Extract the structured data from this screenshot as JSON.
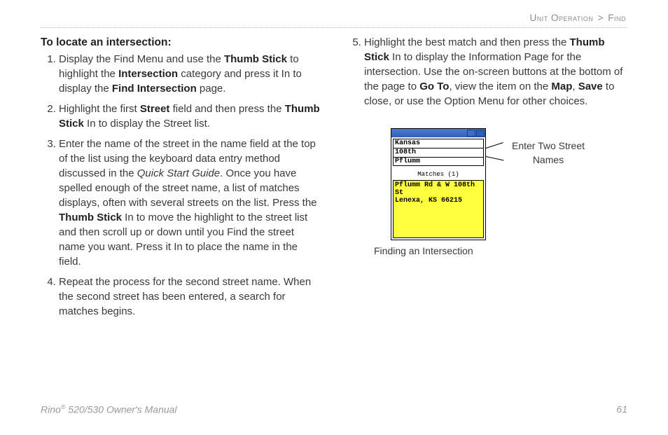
{
  "breadcrumb": {
    "section": "Unit Operation",
    "sep": ">",
    "sub": "Find"
  },
  "heading": "To locate an intersection:",
  "col1": {
    "step1": {
      "pre": "Display the Find Menu and use the ",
      "b1": "Thumb Stick",
      "mid1": " to highlight the ",
      "b2": "Intersection",
      "mid2": " category and press it In to display the ",
      "b3": "Find Intersection",
      "post": " page."
    },
    "step2": {
      "pre": "Highlight the first ",
      "b1": "Street",
      "mid1": " field and then press the ",
      "b2": "Thumb Stick",
      "post": " In to display the Street list."
    },
    "step3": {
      "pre": "Enter the name of the street in the name field at the top of the list using the keyboard data entry method discussed in the ",
      "i1": "Quick Start Guide",
      "mid1": ". Once you have spelled enough of the street name, a list of matches displays, often with several streets on the list. Press the ",
      "b1": "Thumb Stick",
      "post": " In to move the highlight to the street list and then scroll up or down until you Find the street name you want. Press it In to place the name in the field."
    },
    "step4": "Repeat the process for the second street name. When the second street has been entered, a search for matches begins."
  },
  "col2": {
    "step5": {
      "pre": "Highlight the best match and then press the ",
      "b1": "Thumb Stick",
      "mid1": " In to display the Information Page for the intersection. Use the on-screen buttons at the bottom of the page to ",
      "b2": "Go To",
      "mid2": ", view the item on the ",
      "b3": "Map",
      "mid3": ", ",
      "b4": "Save",
      "post": " to close, or use the Option Menu for other choices."
    }
  },
  "device": {
    "field1": "Kansas",
    "field2": "108th",
    "field3": "Pflumm",
    "matches_label": "Matches (1)",
    "match_line1": "Pflumm Rd & W 108th St",
    "match_line2": "Lenexa, KS 66215"
  },
  "callout": "Enter Two Street Names",
  "caption": "Finding an Intersection",
  "footer": {
    "left_pre": "Rino",
    "left_sup": "®",
    "left_post": " 520/530 Owner's Manual",
    "page": "61"
  }
}
